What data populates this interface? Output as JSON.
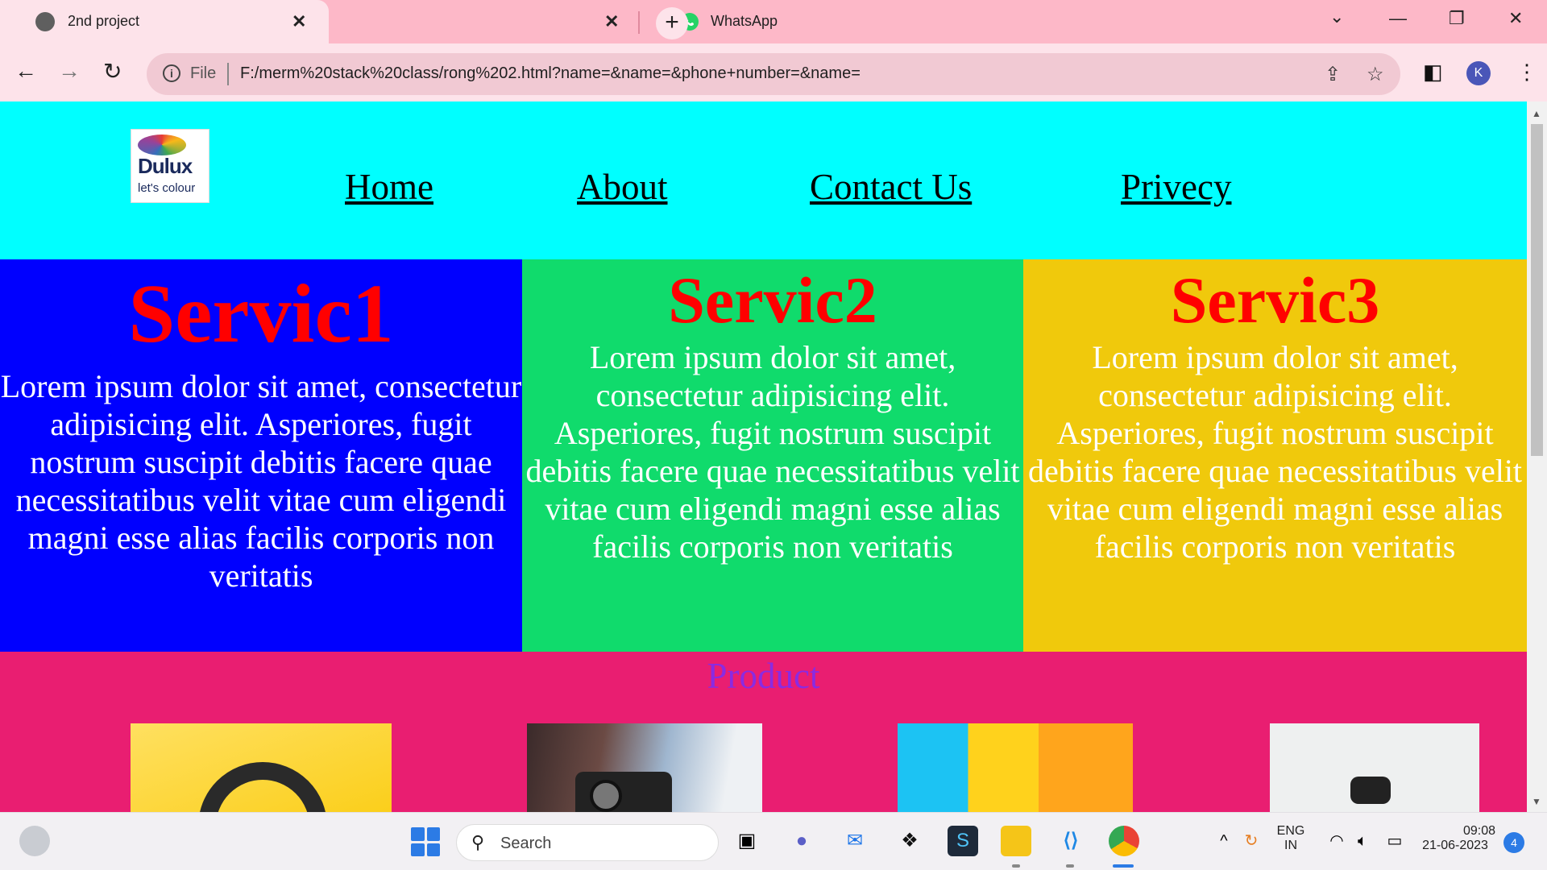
{
  "browser": {
    "tabs": [
      {
        "title": "2nd project",
        "active": true
      },
      {
        "title": "WhatsApp",
        "active": false
      }
    ],
    "new_tab_label": "+",
    "address": {
      "security_label": "File",
      "url": "F:/merm%20stack%20class/rong%202.html?name=&name=&phone+number=&name="
    },
    "profile_initial": "K"
  },
  "site": {
    "logo": {
      "brand": "Dulux",
      "tagline": "let's colour"
    },
    "nav": [
      "Home",
      "About",
      "Contact Us",
      "Privecy"
    ],
    "services": [
      {
        "title": "Servic1",
        "text": "Lorem ipsum dolor sit amet, consectetur adipisicing elit. Asperiores, fugit nostrum suscipit debitis facere quae necessitatibus velit vitae cum eligendi magni esse alias facilis corporis non veritatis",
        "bg": "#0000ff"
      },
      {
        "title": "Servic2",
        "text": "Lorem ipsum dolor sit amet, consectetur adipisicing elit. Asperiores, fugit nostrum suscipit debitis facere quae necessitatibus velit vitae cum eligendi magni esse alias facilis corporis non veritatis",
        "bg": "#10db6c"
      },
      {
        "title": "Servic3",
        "text": "Lorem ipsum dolor sit amet, consectetur adipisicing elit. Asperiores, fugit nostrum suscipit debitis facere quae necessitatibus velit vitae cum eligendi magni esse alias facilis corporis non veritatis",
        "bg": "#f0c90c"
      }
    ],
    "product_title": "Product",
    "colors": {
      "header_bg": "#00ffff",
      "service_title": "#ff0000",
      "product_bg": "#e91e71",
      "product_title": "#8a2be2"
    }
  },
  "taskbar": {
    "search_placeholder": "Search",
    "language": {
      "line1": "ENG",
      "line2": "IN"
    },
    "clock": {
      "time": "09:08",
      "date": "21-06-2023"
    },
    "notification_count": "4"
  }
}
